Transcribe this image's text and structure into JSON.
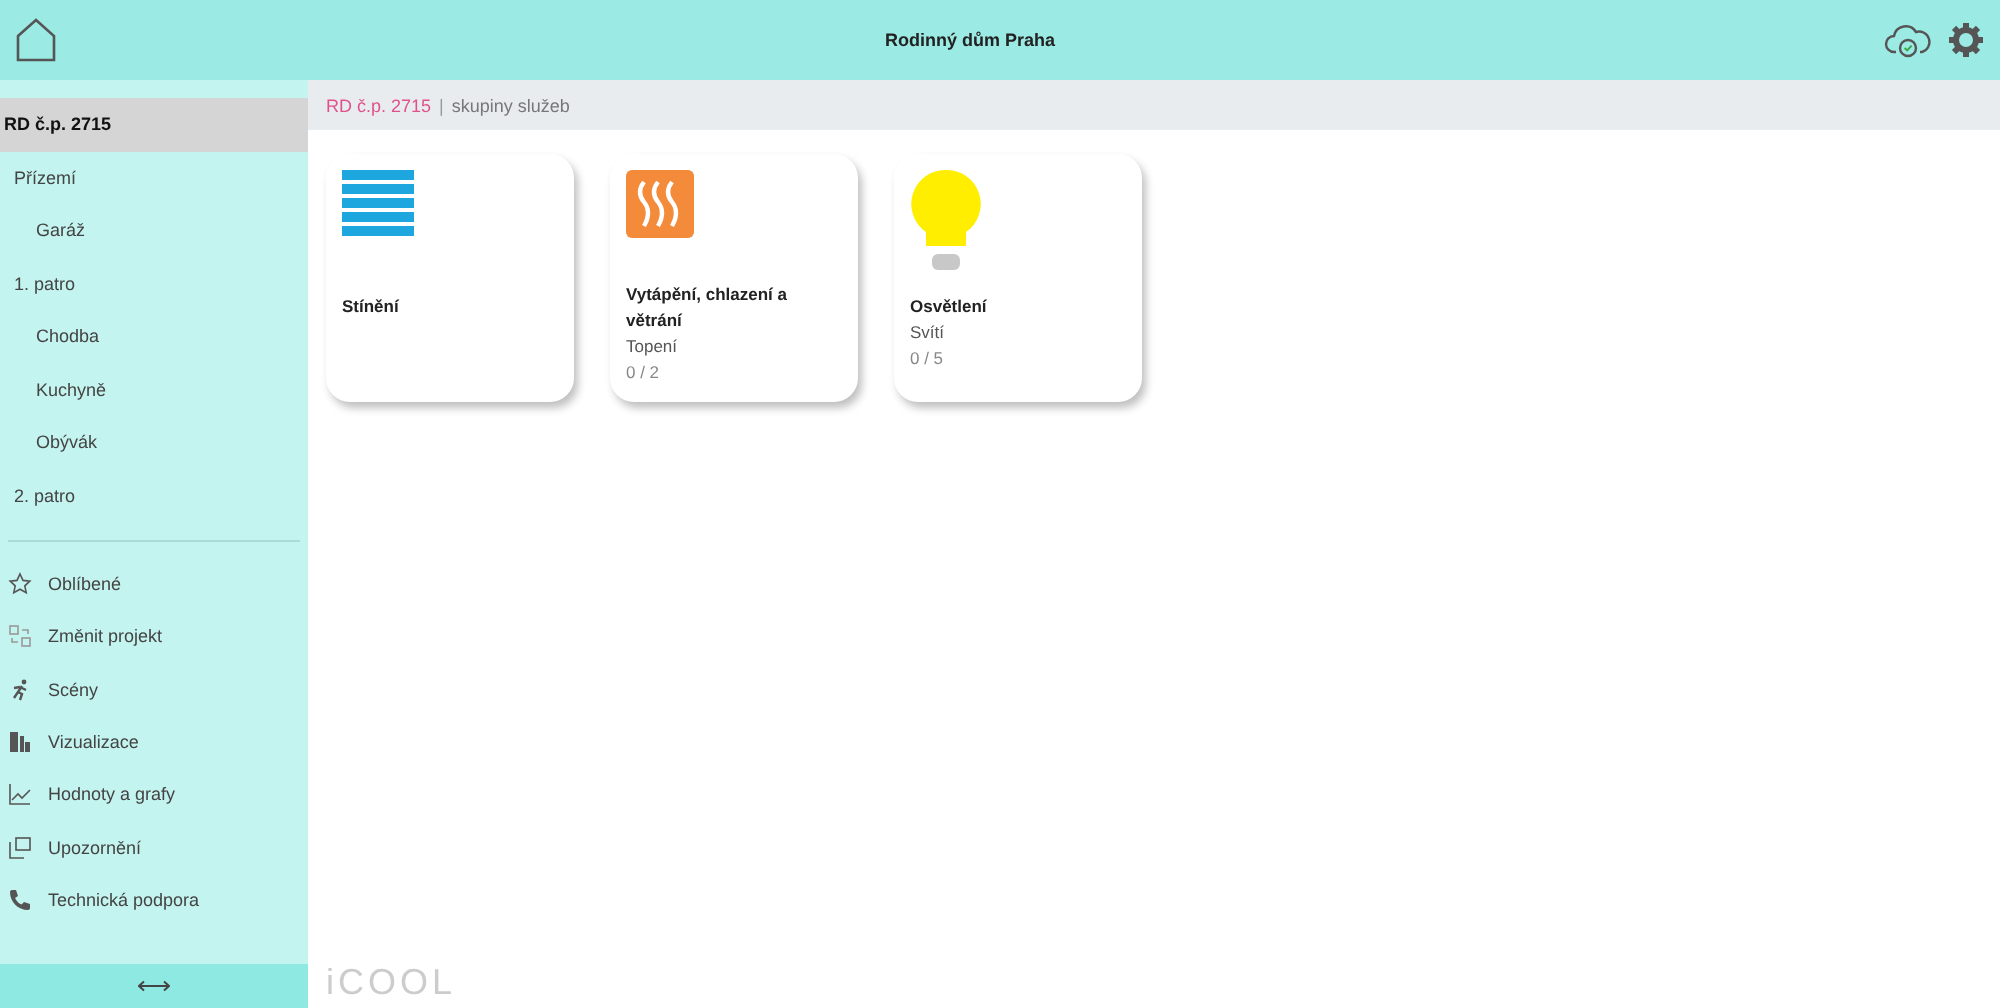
{
  "header": {
    "title": "Rodinný dům Praha"
  },
  "sidebar": {
    "tree": [
      {
        "label": "RD č.p. 2715",
        "selected": true,
        "children": [
          {
            "label": "Přízemí",
            "selected": false,
            "children": [
              {
                "label": "Garáž",
                "selected": false
              }
            ]
          },
          {
            "label": "1. patro",
            "selected": false,
            "children": [
              {
                "label": "Chodba",
                "selected": false
              },
              {
                "label": "Kuchyně",
                "selected": false
              },
              {
                "label": "Obývák",
                "selected": false
              }
            ]
          },
          {
            "label": "2. patro",
            "selected": false
          }
        ]
      }
    ],
    "menu": [
      {
        "kind": "star",
        "label": "Oblíbené"
      },
      {
        "kind": "switch",
        "label": "Změnit projekt"
      },
      {
        "kind": "run",
        "label": "Scény"
      },
      {
        "kind": "blocks",
        "label": "Vizualizace"
      },
      {
        "kind": "chart",
        "label": "Hodnoty a grafy"
      },
      {
        "kind": "alert",
        "label": "Upozornění"
      },
      {
        "kind": "phone",
        "label": "Technická podpora"
      }
    ]
  },
  "breadcrumb": {
    "current": "RD č.p. 2715",
    "separator": "|",
    "section": "skupiny služeb"
  },
  "cards": [
    {
      "kind": "shading",
      "title": "Stínění"
    },
    {
      "kind": "heating",
      "title": "Vytápění, chlazení a větrání",
      "subtitle": "Topení",
      "count": "0 / 2"
    },
    {
      "kind": "lighting",
      "title": "Osvětlení",
      "subtitle": "Svítí",
      "count": "0 / 5"
    }
  ],
  "logo": "iCOOL"
}
